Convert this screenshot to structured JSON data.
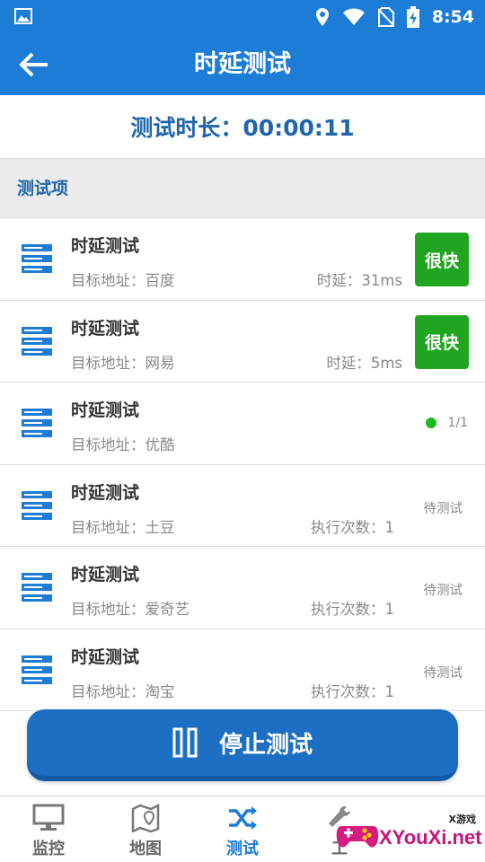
{
  "status_bar": {
    "time": "8:54"
  },
  "app_bar": {
    "title": "时延测试"
  },
  "duration": {
    "text": "测试时长：00:00:11"
  },
  "section": {
    "title": "测试项"
  },
  "items": [
    {
      "title": "时延测试",
      "target": "目标地址：百度",
      "meta": "时延：31ms",
      "badge": "很快"
    },
    {
      "title": "时延测试",
      "target": "目标地址：网易",
      "meta": "时延：5ms",
      "badge": "很快"
    },
    {
      "title": "时延测试",
      "target": "目标地址：优酷",
      "progress": "1/1"
    },
    {
      "title": "时延测试",
      "target": "目标地址：土豆",
      "meta": "执行次数：1",
      "status": "待测试"
    },
    {
      "title": "时延测试",
      "target": "目标地址：爱奇艺",
      "meta": "执行次数：1",
      "status": "待测试"
    },
    {
      "title": "时延测试",
      "target": "目标地址：淘宝",
      "meta": "执行次数：1",
      "status": "待测试"
    }
  ],
  "stop_button": {
    "label": "停止测试"
  },
  "tabs": [
    {
      "label": "监控",
      "icon": "monitor-icon"
    },
    {
      "label": "地图",
      "icon": "map-icon"
    },
    {
      "label": "测试",
      "icon": "shuffle-icon",
      "active": true
    },
    {
      "label": "工",
      "icon": "tool-icon"
    }
  ],
  "watermark": {
    "small": "X游戏",
    "text": "XYouXi.net"
  },
  "colors": {
    "primary": "#1d7cd6",
    "accent_text": "#1f66ad",
    "badge_green": "#1fa51f",
    "status_dot": "#1fb81f"
  }
}
